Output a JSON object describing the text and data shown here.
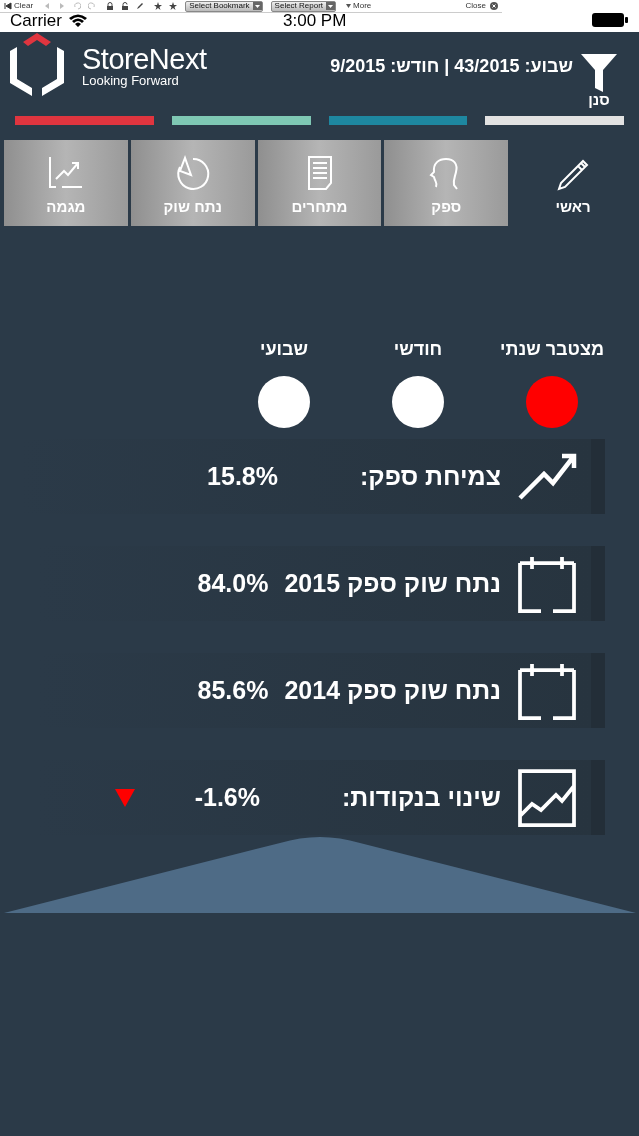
{
  "toolbar": {
    "clear_label": "Clear",
    "bookmark_menu": "Select Bookmark",
    "report_menu": "Select Report",
    "more_label": "More",
    "close_label": "Close"
  },
  "status_bar": {
    "carrier": "Carrier",
    "time": "3:00 PM"
  },
  "header": {
    "brand": "StoreNext",
    "tagline": "Looking Forward",
    "period": "שבוע: 43/2015 | חודש: 9/2015",
    "filter_label": "סנן"
  },
  "color_bars": [
    {
      "color": "#e0353f"
    },
    {
      "color": "#7fc8b4"
    },
    {
      "color": "#1e87a0"
    },
    {
      "color": "#e2e2e2"
    }
  ],
  "tabs": [
    {
      "label": "ראשי",
      "selected": true
    },
    {
      "label": "ספק",
      "selected": false
    },
    {
      "label": "מתחרים",
      "selected": false
    },
    {
      "label": "נתח שוק",
      "selected": false
    },
    {
      "label": "מגמה",
      "selected": false
    }
  ],
  "period_options": [
    {
      "label": "מצטבר שנתי",
      "selected": true
    },
    {
      "label": "חודשי",
      "selected": false
    },
    {
      "label": "שבועי",
      "selected": false
    }
  ],
  "metrics": [
    {
      "kind": "growth",
      "label": "צמיחת ספק:",
      "value": "15.8%"
    },
    {
      "kind": "calendar",
      "label": "נתח שוק ספק 2015",
      "value": "84.0%"
    },
    {
      "kind": "calendar",
      "label": "נתח שוק ספק 2014",
      "value": "85.6%"
    },
    {
      "kind": "chart",
      "label": "שינוי בנקודות:",
      "value": "-1.6%",
      "declining": true
    }
  ]
}
